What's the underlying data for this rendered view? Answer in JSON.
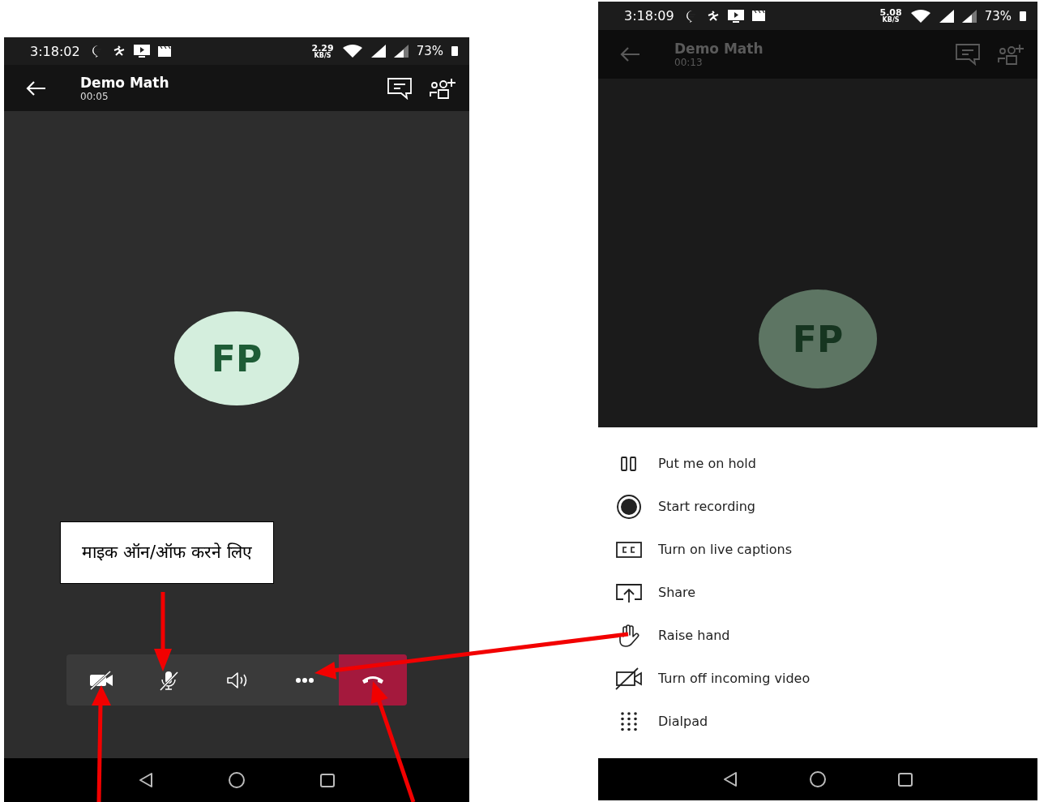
{
  "phones": [
    {
      "dimmed": false,
      "status_bar": {
        "time": "3:18:02",
        "speed": "2.29",
        "speed_unit": "KB/S",
        "battery": "73%"
      },
      "header": {
        "title": "Demo Math",
        "duration": "00:05"
      },
      "avatar": {
        "initials": "FP"
      },
      "call_controls": [
        {
          "kind": "camera-off"
        },
        {
          "kind": "mic-off"
        },
        {
          "kind": "speaker"
        },
        {
          "kind": "more"
        },
        {
          "kind": "end-call"
        }
      ]
    },
    {
      "dimmed": true,
      "status_bar": {
        "time": "3:18:09",
        "speed": "5.08",
        "speed_unit": "KB/S",
        "battery": "73%"
      },
      "header": {
        "title": "Demo Math",
        "duration": "00:13"
      },
      "avatar": {
        "initials": "FP"
      },
      "menu": [
        {
          "kind": "hold",
          "label": "Put me on hold"
        },
        {
          "kind": "record",
          "label": "Start recording"
        },
        {
          "kind": "captions",
          "label": "Turn on live captions"
        },
        {
          "kind": "share",
          "label": "Share"
        },
        {
          "kind": "hand",
          "label": "Raise hand"
        },
        {
          "kind": "video-off",
          "label": "Turn off incoming video"
        },
        {
          "kind": "dialpad",
          "label": "Dialpad"
        }
      ]
    }
  ],
  "callout": {
    "text": "माइक ऑन/ऑफ करने लिए"
  }
}
